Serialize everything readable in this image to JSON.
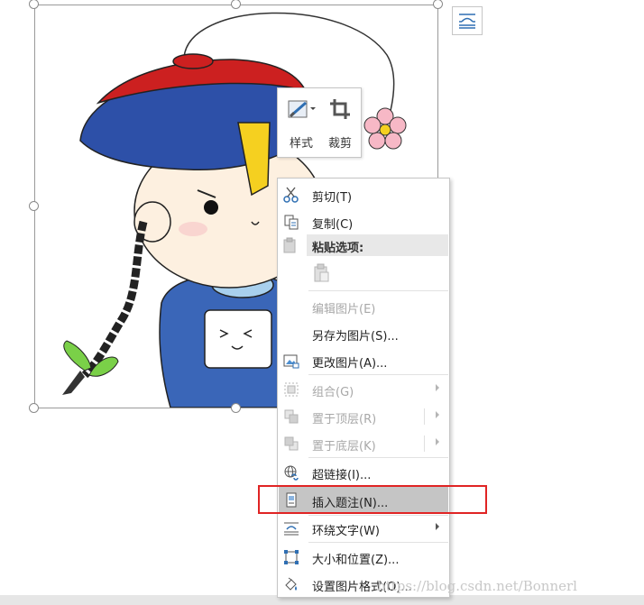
{
  "mini_toolbar": {
    "style_label": "样式",
    "crop_label": "裁剪"
  },
  "context_menu": {
    "items": [
      {
        "label": "剪切(T)",
        "icon": "scissors-icon",
        "enabled": true
      },
      {
        "label": "复制(C)",
        "icon": "copy-icon",
        "enabled": true
      },
      {
        "label": "编辑图片(E)",
        "enabled": false
      },
      {
        "label": "另存为图片(S)...",
        "enabled": true
      },
      {
        "label": "更改图片(A)...",
        "icon": "change-picture-icon",
        "enabled": true
      },
      {
        "label": "组合(G)",
        "icon": "group-icon",
        "enabled": false,
        "submenu": true
      },
      {
        "label": "置于顶层(R)",
        "icon": "bring-to-front-icon",
        "enabled": false,
        "submenu": true
      },
      {
        "label": "置于底层(K)",
        "icon": "send-to-back-icon",
        "enabled": false,
        "submenu": true
      },
      {
        "label": "超链接(I)...",
        "icon": "hyperlink-icon",
        "enabled": true
      },
      {
        "label": "插入题注(N)...",
        "icon": "insert-caption-icon",
        "enabled": true,
        "highlighted": true
      },
      {
        "label": "环绕文字(W)",
        "icon": "wrap-text-icon",
        "enabled": true,
        "submenu": true
      },
      {
        "label": "大小和位置(Z)...",
        "icon": "size-position-icon",
        "enabled": true
      },
      {
        "label": "设置图片格式(O)...",
        "icon": "format-picture-icon",
        "enabled": true
      }
    ],
    "paste_section": {
      "header": "粘贴选项:",
      "icon": "clipboard-icon"
    }
  },
  "watermark": "https://blog.csdn.net/Bonnerl",
  "colors": {
    "highlight": "#c5c5c5",
    "annotation_box": "#e02424"
  }
}
